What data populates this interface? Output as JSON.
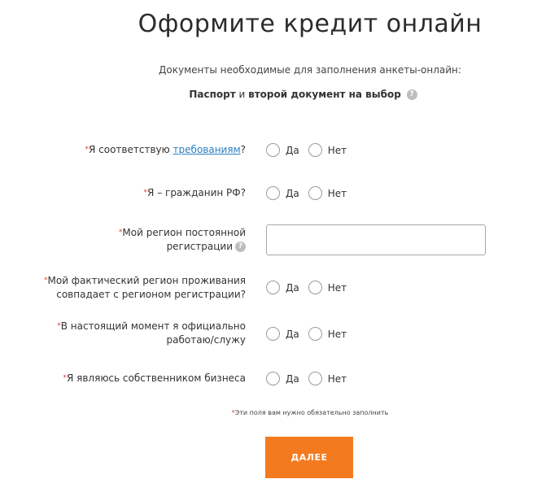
{
  "title": "Оформите кредит онлайн",
  "documents": {
    "intro": "Документы необходимые для заполнения анкеты-онлайн:",
    "passport": "Паспорт",
    "and": "и",
    "second_doc": "второй документ на выбор",
    "help_glyph": "?"
  },
  "required_mark": "*",
  "questions": [
    {
      "prefix": "Я соответствую ",
      "link": "требованиям",
      "suffix": "?",
      "yes": "Да",
      "no": "Нет"
    },
    {
      "text": "Я – гражданин РФ?",
      "yes": "Да",
      "no": "Нет"
    },
    {
      "line1": "Мой регион постоянной",
      "line2": "регистрации",
      "help_glyph": "?",
      "value": "",
      "placeholder": ""
    },
    {
      "line1": "Мой фактический регион проживания",
      "line2": "совпадает с регионом регистрации?",
      "yes": "Да",
      "no": "Нет"
    },
    {
      "line1": "В настоящий момент я официально",
      "line2": "работаю/служу",
      "yes": "Да",
      "no": "Нет"
    },
    {
      "text": "Я являюсь собственником бизнеса",
      "yes": "Да",
      "no": "Нет"
    }
  ],
  "required_note": "Эти поля вам нужно обязательно заполнить",
  "submit_label": "ДАЛЕЕ",
  "colors": {
    "accent": "#f47a1f",
    "link": "#2a7fc1",
    "required": "#e53935"
  }
}
